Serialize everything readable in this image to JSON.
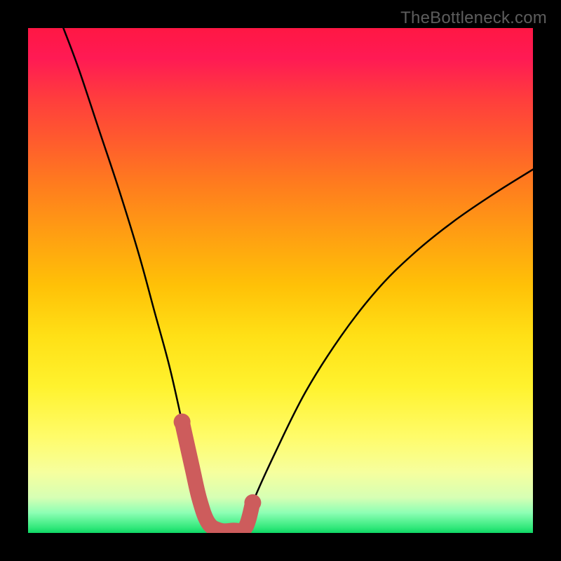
{
  "watermark": "TheBottleneck.com",
  "chart_data": {
    "type": "line",
    "title": "",
    "xlabel": "",
    "ylabel": "",
    "xlim": [
      0,
      100
    ],
    "ylim": [
      0,
      100
    ],
    "grid": false,
    "legend": "none",
    "series": [
      {
        "name": "bottleneck-curve",
        "x": [
          7,
          10,
          14,
          18,
          22,
          25,
          28,
          30.5,
          32.5,
          34,
          38,
          40.5,
          43,
          44.5,
          49,
          55,
          62,
          69,
          76,
          84,
          92,
          100
        ],
        "y": [
          100,
          92,
          80,
          68,
          55,
          44,
          33,
          22,
          13,
          6.5,
          0.5,
          0.5,
          1,
          6,
          16,
          28,
          39,
          48,
          55,
          61.5,
          67,
          72
        ]
      }
    ],
    "highlight": {
      "name": "optimal-zone",
      "color": "#cd5c5c",
      "x": [
        30.5,
        32.5,
        34,
        35.7,
        38,
        40.5,
        43,
        44.5
      ],
      "y": [
        22,
        13,
        6.5,
        2,
        0.5,
        0.5,
        1,
        6
      ]
    },
    "gradient_stops": [
      {
        "pos": 0,
        "color": "#ff1744"
      },
      {
        "pos": 50,
        "color": "#ffeb3b"
      },
      {
        "pos": 100,
        "color": "#0fd665"
      }
    ]
  }
}
